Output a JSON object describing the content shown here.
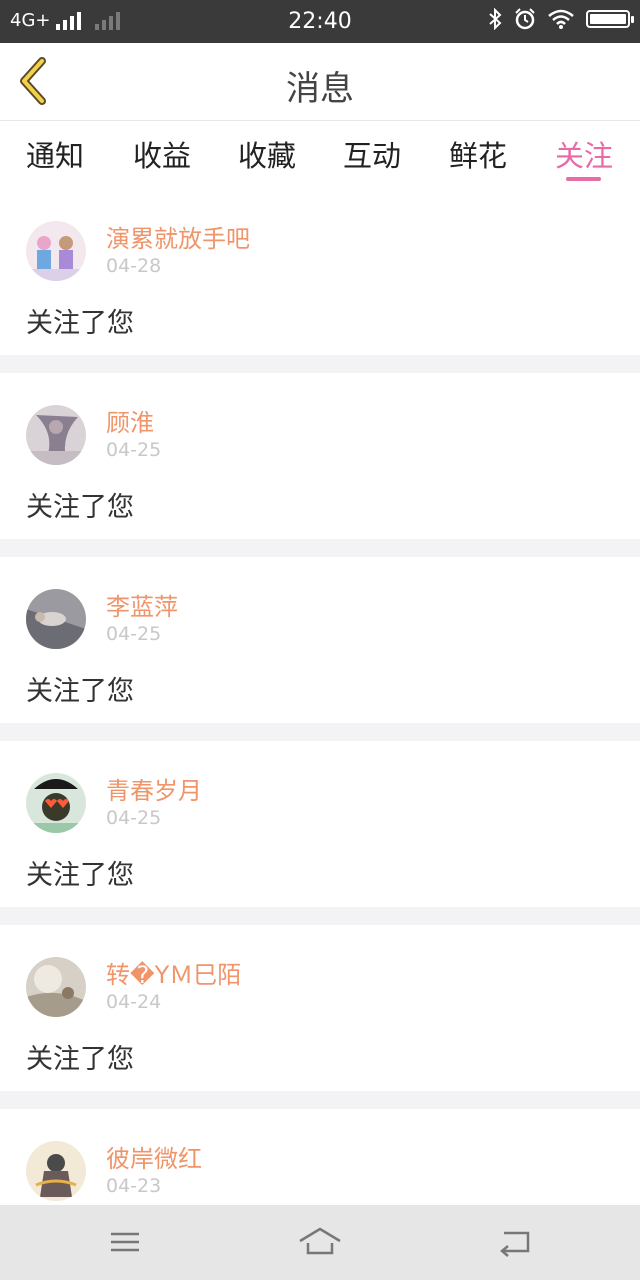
{
  "status_bar": {
    "network": "4G+",
    "time": "22:40"
  },
  "header": {
    "title": "消息"
  },
  "tabs": [
    {
      "label": "通知",
      "active": false
    },
    {
      "label": "收益",
      "active": false
    },
    {
      "label": "收藏",
      "active": false
    },
    {
      "label": "互动",
      "active": false
    },
    {
      "label": "鲜花",
      "active": false
    },
    {
      "label": "关注",
      "active": true
    }
  ],
  "notifications": [
    {
      "name": "演累就放手吧",
      "date": "04-28",
      "message": "关注了您"
    },
    {
      "name": "顾淮",
      "date": "04-25",
      "message": "关注了您"
    },
    {
      "name": "李蓝萍",
      "date": "04-25",
      "message": "关注了您"
    },
    {
      "name": "青春岁月",
      "date": "04-25",
      "message": "关注了您"
    },
    {
      "name": "转�YＭ巳陌",
      "date": "04-24",
      "message": "关注了您"
    },
    {
      "name": "彼岸微红",
      "date": "04-23",
      "message": ""
    }
  ],
  "colors": {
    "accent": "#e86aa8",
    "name": "#f0956a",
    "date": "#c8c8c8",
    "statusbar": "#3a3a3a",
    "navbar": "#e6e6e6"
  }
}
